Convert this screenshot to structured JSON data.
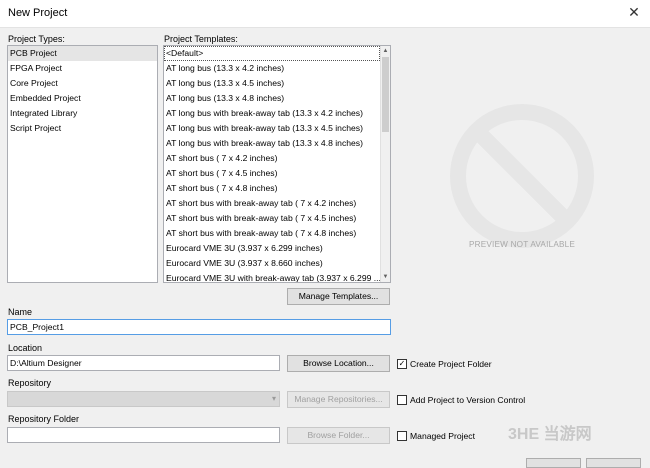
{
  "window": {
    "title": "New Project"
  },
  "project_types": {
    "label": "Project Types:",
    "items": [
      "PCB Project",
      "FPGA Project",
      "Core Project",
      "Embedded Project",
      "Integrated Library",
      "Script Project"
    ],
    "selected_index": 0
  },
  "project_templates": {
    "label": "Project Templates:",
    "items": [
      "<Default>",
      "AT long bus (13.3 x 4.2 inches)",
      "AT long bus (13.3 x 4.5 inches)",
      "AT long bus (13.3 x 4.8 inches)",
      "AT long bus with break-away tab (13.3 x 4.2 inches)",
      "AT long bus with break-away tab (13.3 x 4.5 inches)",
      "AT long bus with break-away tab (13.3 x 4.8 inches)",
      "AT short bus ( 7 x 4.2 inches)",
      "AT short bus ( 7 x 4.5 inches)",
      "AT short bus ( 7 x 4.8 inches)",
      "AT short bus with break-away tab ( 7 x 4.2 inches)",
      "AT short bus with break-away tab ( 7 x 4.5 inches)",
      "AT short bus with break-away tab ( 7 x 4.8 inches)",
      "Eurocard VME 3U (3.937 x 6.299 inches)",
      "Eurocard VME 3U (3.937 x 8.660 inches)",
      "Eurocard VME 3U with break-away tab (3.937 x 6.299 ..."
    ],
    "selected_index": 0,
    "manage_button": "Manage Templates..."
  },
  "preview": {
    "text": "PREVIEW NOT AVAILABLE"
  },
  "name": {
    "label": "Name",
    "value": "PCB_Project1"
  },
  "location": {
    "label": "Location",
    "value": "D:\\Altium Designer",
    "browse_button": "Browse Location...",
    "create_folder_label": "Create Project Folder",
    "create_folder_checked": true
  },
  "repository": {
    "label": "Repository",
    "value": "",
    "manage_button": "Manage Repositories...",
    "version_control_label": "Add Project to Version Control",
    "version_control_checked": false
  },
  "repository_folder": {
    "label": "Repository Folder",
    "value": "",
    "browse_button": "Browse Folder...",
    "managed_label": "Managed Project",
    "managed_checked": false
  },
  "watermark": {
    "text": "3HE 当游网"
  },
  "icons": {
    "close": "close-icon",
    "preview": "no-entry-icon",
    "dropdown": "chevron-down-icon",
    "check": "check-icon"
  }
}
